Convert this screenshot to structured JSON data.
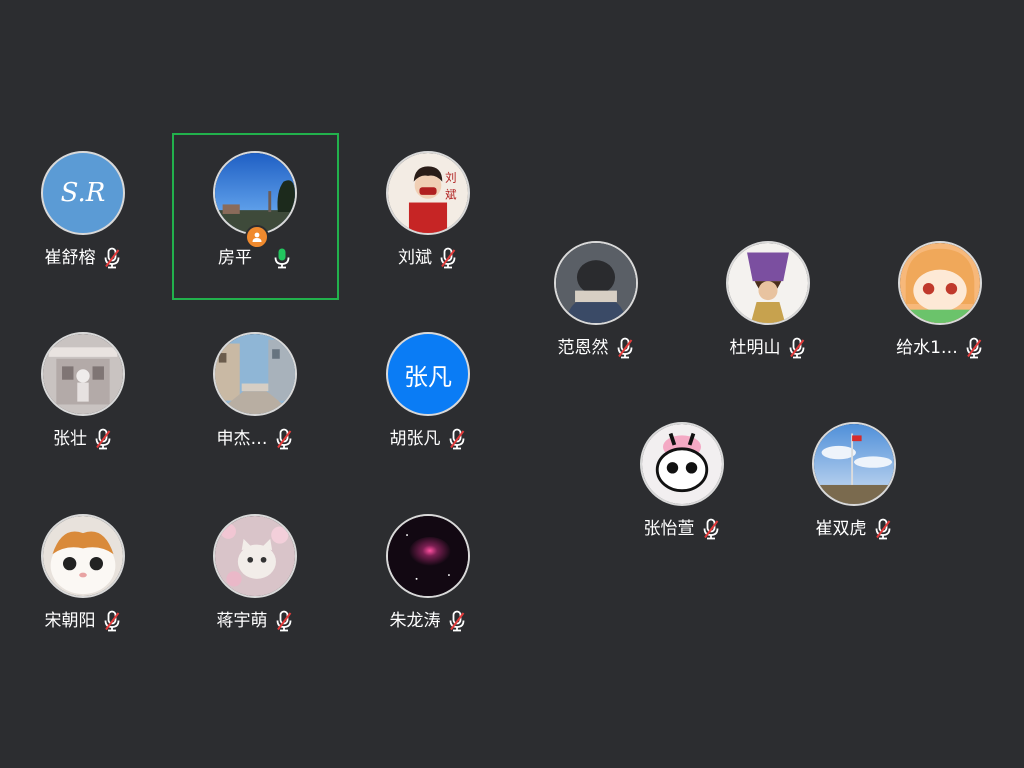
{
  "participants_left": [
    {
      "name": "崔舒榕",
      "mic": "muted",
      "avatar_type": "text",
      "avatar_text": "S.R",
      "avatar_color": "#5b9bd5"
    },
    {
      "name": "房平",
      "mic": "active",
      "avatar_type": "photo",
      "host": true,
      "speaking": true
    },
    {
      "name": "刘斌",
      "mic": "muted",
      "avatar_type": "photo"
    },
    {
      "name": "张壮",
      "mic": "muted",
      "avatar_type": "photo"
    },
    {
      "name": "申杰…",
      "mic": "muted",
      "avatar_type": "photo"
    },
    {
      "name": "胡张凡",
      "mic": "muted",
      "avatar_type": "text",
      "avatar_text": "张凡",
      "avatar_color": "#0a7cf5"
    },
    {
      "name": "宋朝阳",
      "mic": "muted",
      "avatar_type": "photo"
    },
    {
      "name": "蒋宇萌",
      "mic": "muted",
      "avatar_type": "photo"
    },
    {
      "name": "朱龙涛",
      "mic": "muted",
      "avatar_type": "photo"
    }
  ],
  "participants_right": [
    {
      "name": "范恩然",
      "mic": "muted",
      "avatar_type": "photo"
    },
    {
      "name": "杜明山",
      "mic": "muted",
      "avatar_type": "photo"
    },
    {
      "name": "给水1…",
      "mic": "muted",
      "avatar_type": "photo"
    },
    {
      "name": "张怡萱",
      "mic": "muted",
      "avatar_type": "photo"
    },
    {
      "name": "崔双虎",
      "mic": "muted",
      "avatar_type": "photo"
    }
  ],
  "colors": {
    "background": "#2c2d30",
    "speaking_border": "#22b14c",
    "mic_active": "#22c55e",
    "mic_muted_slash": "#e23b3b",
    "host_badge": "#f08a2e"
  },
  "icons": {
    "mic_muted": "mic-muted-icon",
    "mic_active": "mic-icon",
    "host": "host-person-icon"
  }
}
